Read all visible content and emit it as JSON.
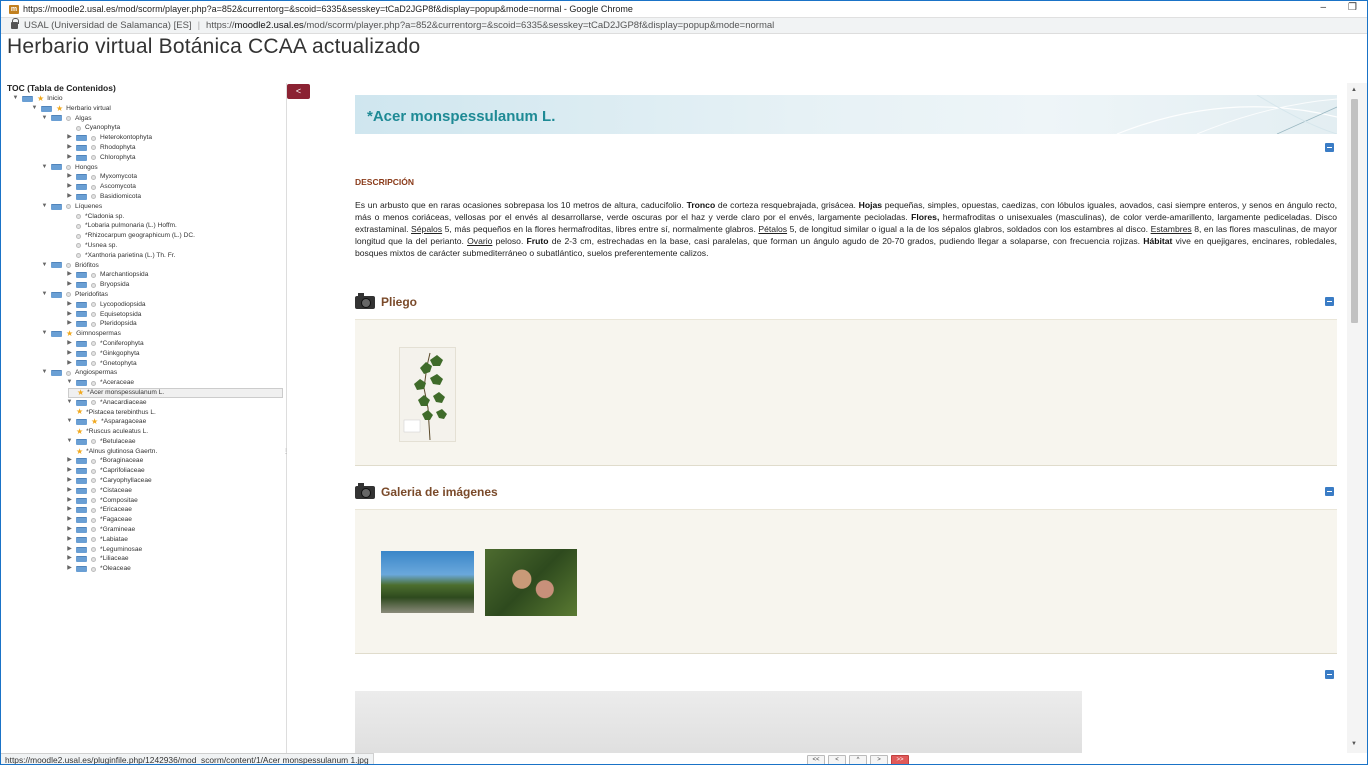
{
  "browser": {
    "window_title": "https://moodle2.usal.es/mod/scorm/player.php?a=852&currentorg=&scoid=6335&sesskey=tCaD2JGP8f&display=popup&mode=normal - Google Chrome",
    "cert_owner": "USAL (Universidad de Salamanca) [ES]",
    "url_scheme": "https://",
    "url_host": "moodle2.usal.es",
    "url_path": "/mod/scorm/player.php?a=852&currentorg=&scoid=6335&sesskey=tCaD2JGP8f&display=popup&mode=normal",
    "status_url": "https://moodle2.usal.es/pluginfile.php/1242936/mod_scorm/content/1/Acer monspessulanum 1.jpg"
  },
  "page_title": "Herbario virtual Botánica CCAA actualizado",
  "toc": {
    "title": "TOC (Tabla de Contenidos)",
    "collapse_label": "<",
    "items": [
      {
        "label": "Inicio",
        "level": 0,
        "toggle": "open",
        "kind": "star"
      },
      {
        "label": "Herbario virtual",
        "level": 1,
        "toggle": "open",
        "kind": "star"
      },
      {
        "label": "Algas",
        "level": 2,
        "toggle": "open",
        "kind": "dot"
      },
      {
        "label": "Cyanophyta",
        "level": 3,
        "toggle": "none",
        "kind": "dot"
      },
      {
        "label": "Heterokontophyta",
        "level": 3,
        "toggle": "closed",
        "kind": "dot"
      },
      {
        "label": "Rhodophyta",
        "level": 3,
        "toggle": "closed",
        "kind": "dot"
      },
      {
        "label": "Chlorophyta",
        "level": 3,
        "toggle": "closed",
        "kind": "dot"
      },
      {
        "label": "Hongos",
        "level": 2,
        "toggle": "open",
        "kind": "dot"
      },
      {
        "label": "Myxomycota",
        "level": 3,
        "toggle": "closed",
        "kind": "dot"
      },
      {
        "label": "Ascomycota",
        "level": 3,
        "toggle": "closed",
        "kind": "dot"
      },
      {
        "label": "Basidiomicota",
        "level": 3,
        "toggle": "closed",
        "kind": "dot"
      },
      {
        "label": "Líquenes",
        "level": 2,
        "toggle": "open",
        "kind": "dot"
      },
      {
        "label": "*Cladonia sp.",
        "level": 4,
        "toggle": "none",
        "kind": "dot"
      },
      {
        "label": "*Lobaria pulmonaria (L.) Hoffm.",
        "level": 4,
        "toggle": "none",
        "kind": "dot"
      },
      {
        "label": "*Rhizocarpum geographicum (L.) DC.",
        "level": 4,
        "toggle": "none",
        "kind": "dot"
      },
      {
        "label": "*Usnea sp.",
        "level": 4,
        "toggle": "none",
        "kind": "dot"
      },
      {
        "label": "*Xanthoria parietina (L.) Th. Fr.",
        "level": 4,
        "toggle": "none",
        "kind": "dot"
      },
      {
        "label": "Briófitos",
        "level": 2,
        "toggle": "open",
        "kind": "dot"
      },
      {
        "label": "Marchantiopsida",
        "level": 3,
        "toggle": "closed",
        "kind": "dot"
      },
      {
        "label": "Bryopsida",
        "level": 3,
        "toggle": "closed",
        "kind": "dot"
      },
      {
        "label": "Pteridofitas",
        "level": 2,
        "toggle": "open",
        "kind": "dot"
      },
      {
        "label": "Lycopodiopsida",
        "level": 3,
        "toggle": "closed",
        "kind": "dot"
      },
      {
        "label": "Equisetopsida",
        "level": 3,
        "toggle": "closed",
        "kind": "dot"
      },
      {
        "label": "Pteridopsida",
        "level": 3,
        "toggle": "closed",
        "kind": "dot"
      },
      {
        "label": "Gimnospermas",
        "level": 2,
        "toggle": "open",
        "kind": "star"
      },
      {
        "label": "*Coniferophyta",
        "level": 3,
        "toggle": "closed",
        "kind": "dot"
      },
      {
        "label": "*Ginkgophyta",
        "level": 3,
        "toggle": "closed",
        "kind": "dot"
      },
      {
        "label": "*Gnetophyta",
        "level": 3,
        "toggle": "closed",
        "kind": "dot"
      },
      {
        "label": "Angiospermas",
        "level": 2,
        "toggle": "open",
        "kind": "dot"
      },
      {
        "label": "*Aceraceae",
        "level": 3,
        "toggle": "open",
        "kind": "dot"
      },
      {
        "label": "*Acer monspessulanum L.",
        "level": 4,
        "toggle": "none",
        "kind": "star",
        "selected": true
      },
      {
        "label": "*Anacardiaceae",
        "level": 3,
        "toggle": "open",
        "kind": "dot"
      },
      {
        "label": "*Pistacea terebinthus L.",
        "level": 4,
        "toggle": "none",
        "kind": "star"
      },
      {
        "label": "*Asparagaceae",
        "level": 3,
        "toggle": "open",
        "kind": "star"
      },
      {
        "label": "*Ruscus aculeatus L.",
        "level": 4,
        "toggle": "none",
        "kind": "star"
      },
      {
        "label": "*Betulaceae",
        "level": 3,
        "toggle": "open",
        "kind": "dot"
      },
      {
        "label": "*Alnus glutinosa Gaertn.",
        "level": 4,
        "toggle": "none",
        "kind": "star"
      },
      {
        "label": "*Boraginaceae",
        "level": 3,
        "toggle": "closed",
        "kind": "dot"
      },
      {
        "label": "*Caprifoliaceae",
        "level": 3,
        "toggle": "closed",
        "kind": "dot"
      },
      {
        "label": "*Caryophyllaceae",
        "level": 3,
        "toggle": "closed",
        "kind": "dot"
      },
      {
        "label": "*Cistaceae",
        "level": 3,
        "toggle": "closed",
        "kind": "dot"
      },
      {
        "label": "*Compositae",
        "level": 3,
        "toggle": "closed",
        "kind": "dot"
      },
      {
        "label": "*Ericaceae",
        "level": 3,
        "toggle": "closed",
        "kind": "dot"
      },
      {
        "label": "*Fagaceae",
        "level": 3,
        "toggle": "closed",
        "kind": "dot"
      },
      {
        "label": "*Gramineae",
        "level": 3,
        "toggle": "closed",
        "kind": "dot"
      },
      {
        "label": "*Labiatae",
        "level": 3,
        "toggle": "closed",
        "kind": "dot"
      },
      {
        "label": "*Leguminosae",
        "level": 3,
        "toggle": "closed",
        "kind": "dot"
      },
      {
        "label": "*Liliaceae",
        "level": 3,
        "toggle": "closed",
        "kind": "dot"
      },
      {
        "label": "*Oleaceae",
        "level": 3,
        "toggle": "closed",
        "kind": "dot"
      }
    ]
  },
  "content": {
    "species_title": "*Acer monspessulanum L.",
    "description_heading": "DESCRIPCIÓN",
    "description_parts": [
      {
        "t": "Es un arbusto que en raras ocasiones sobrepasa los 10 metros de altura, caducifolio. ",
        "s": ""
      },
      {
        "t": "Tronco",
        "s": "b"
      },
      {
        "t": " de corteza resquebrajada, grisácea. ",
        "s": ""
      },
      {
        "t": "Hojas",
        "s": "b"
      },
      {
        "t": " pequeñas, simples, opuestas, caedizas, con lóbulos iguales, aovados, casi siempre enteros, y senos en ángulo recto, más o menos coriáceas, vellosas por el envés al desarrollarse, verde oscuras por el haz y verde claro por el envés, largamente pecioladas. ",
        "s": ""
      },
      {
        "t": "Flores,",
        "s": "b"
      },
      {
        "t": " hermafroditas o unisexuales (masculinas), de color  verde-amarillento, largamente pediceladas. Disco extrastaminal. ",
        "s": ""
      },
      {
        "t": "Sépalos",
        "s": "u"
      },
      {
        "t": " 5, más pequeños en la flores hermafroditas, libres entre sí, normalmente glabros.  ",
        "s": ""
      },
      {
        "t": "Pétalos",
        "s": "u"
      },
      {
        "t": " 5,  de longitud similar o igual a la de los sépalos  glabros, soldados con los estambres al disco. ",
        "s": ""
      },
      {
        "t": "Estambres",
        "s": "u"
      },
      {
        "t": " 8, en las flores masculinas, de mayor longitud que la del perianto. ",
        "s": ""
      },
      {
        "t": "Ovario",
        "s": "u"
      },
      {
        "t": " peloso. ",
        "s": ""
      },
      {
        "t": "Fruto",
        "s": "b"
      },
      {
        "t": " de 2-3 cm, estrechadas en la base, casi paralelas, que forman un ángulo agudo de 20-70 grados, pudiendo llegar a solaparse, con frecuencia rojizas. ",
        "s": ""
      },
      {
        "t": "Hábitat",
        "s": "b"
      },
      {
        "t": " vive en quejigares, encinares, robledales, bosques mixtos de carácter submediterráneo o subatlántico, suelos preferentemente calizos.",
        "s": ""
      }
    ],
    "pliego_heading": "Pliego",
    "gallery_heading": "Galeria de imágenes"
  },
  "nav": {
    "first": "<<",
    "prev": "<",
    "up": "^",
    "next_one": ">",
    "next": ">>"
  },
  "colors": {
    "accent_title": "#1e8a95",
    "toc_button": "#8b2233",
    "section_heading": "#8a3b1a",
    "minus_button": "#3a7cc5"
  }
}
